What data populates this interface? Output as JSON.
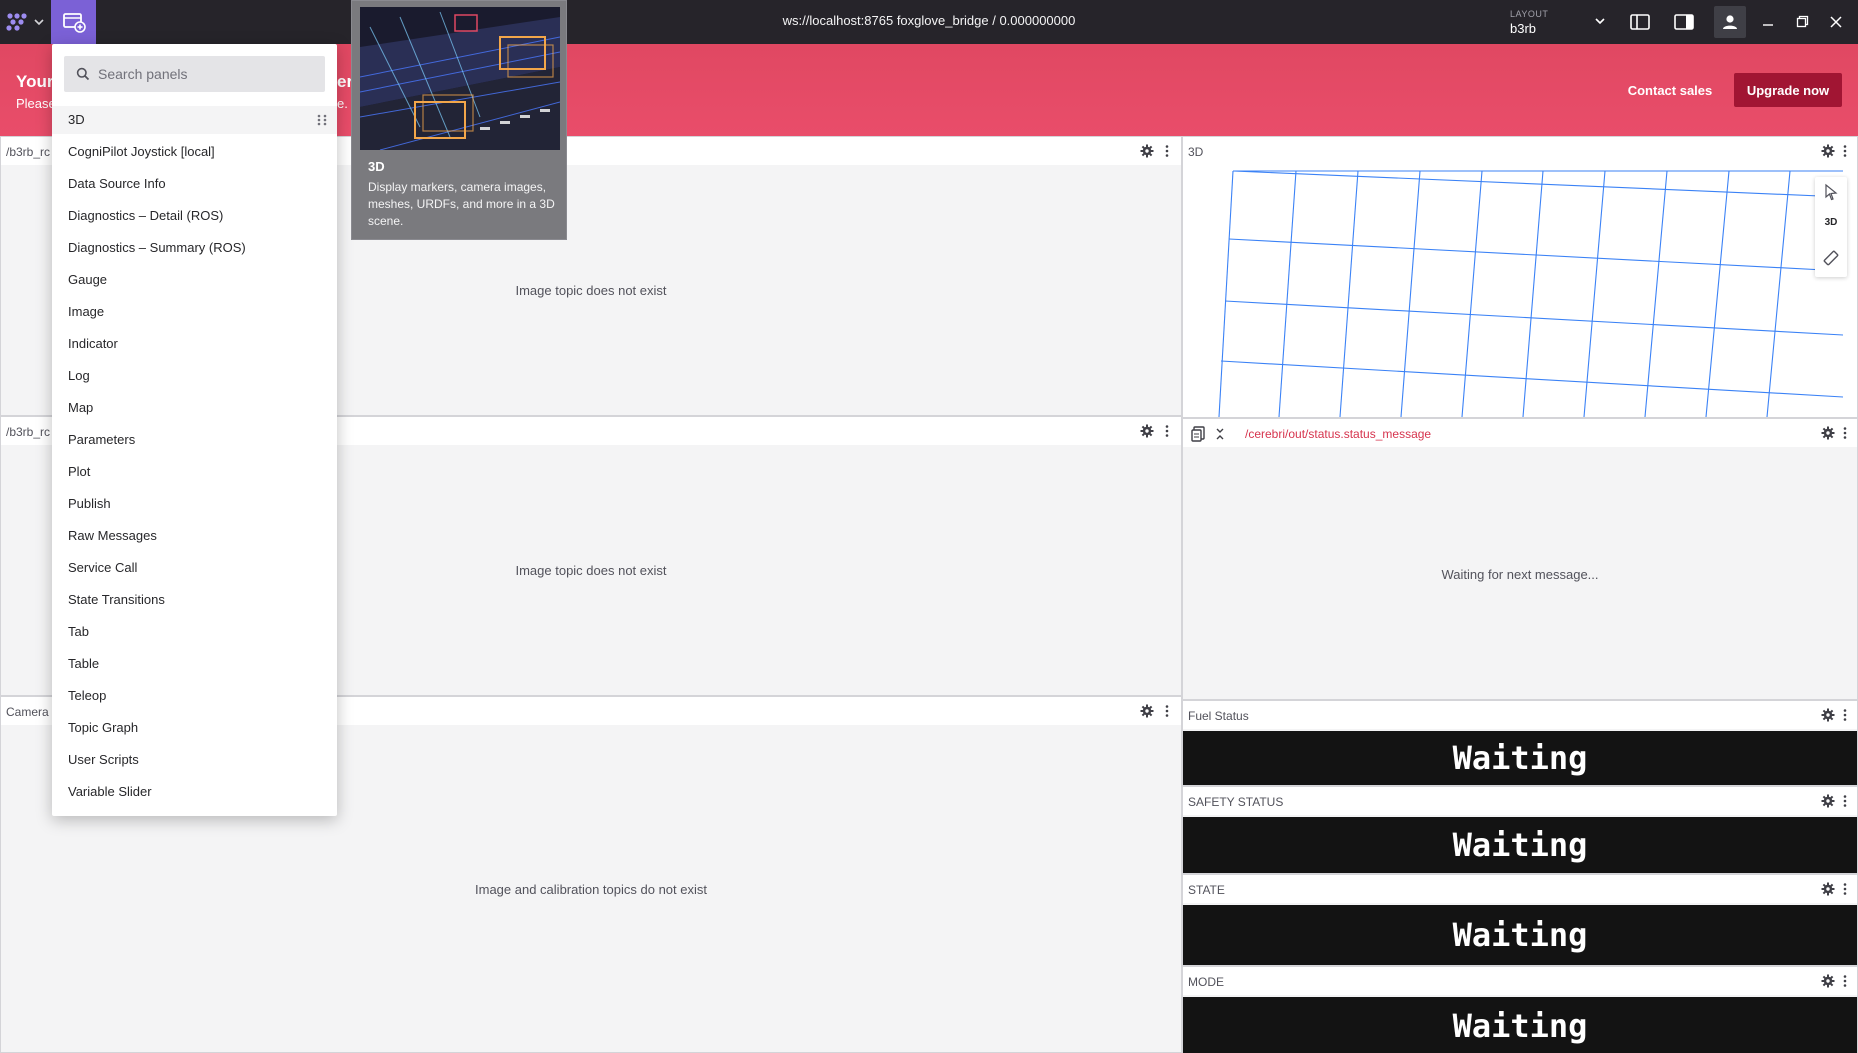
{
  "topbar": {
    "connection": "ws://localhost:8765 foxglove_bridge / 0.000000000",
    "layout_caption": "LAYOUT",
    "layout_name": "b3rb"
  },
  "banner": {
    "title": "Your",
    "title_fragment": "er",
    "subtitle": "Please",
    "subtitle_fragment": "e.",
    "contact_sales": "Contact sales",
    "upgrade_now": "Upgrade now"
  },
  "panels": {
    "left_top": {
      "title": "/b3rb_rc",
      "message": "Image topic does not exist"
    },
    "left_mid": {
      "title": "/b3rb_rc",
      "message": "Image topic does not exist"
    },
    "left_bot": {
      "title": "Camera",
      "message": "Image and calibration topics do not exist"
    },
    "right_3d": {
      "title": "3D",
      "mode": "3D"
    },
    "right_status": {
      "topic": "/cerebri/out/status.status_message",
      "message": "Waiting for next message..."
    },
    "fuel": {
      "title": "Fuel Status",
      "value": "Waiting"
    },
    "safety": {
      "title": "SAFETY STATUS",
      "value": "Waiting"
    },
    "state": {
      "title": "STATE",
      "value": "Waiting"
    },
    "mode": {
      "title": "MODE",
      "value": "Waiting"
    }
  },
  "panel_menu": {
    "search_placeholder": "Search panels",
    "items": [
      "3D",
      "CogniPilot Joystick [local]",
      "Data Source Info",
      "Diagnostics – Detail (ROS)",
      "Diagnostics – Summary (ROS)",
      "Gauge",
      "Image",
      "Indicator",
      "Log",
      "Map",
      "Parameters",
      "Plot",
      "Publish",
      "Raw Messages",
      "Service Call",
      "State Transitions",
      "Tab",
      "Table",
      "Teleop",
      "Topic Graph",
      "User Scripts",
      "Variable Slider"
    ]
  },
  "preview": {
    "title": "3D",
    "description": "Display markers, camera images, meshes, URDFs, and more in a 3D scene."
  },
  "colors": {
    "topbar": "#26242a",
    "accent": "#7b61d6",
    "banner": "#e94d6a",
    "upgrade": "#a11533",
    "grid": "#3b82f6",
    "topic_red": "#d6344e",
    "indicator": "#131313"
  }
}
